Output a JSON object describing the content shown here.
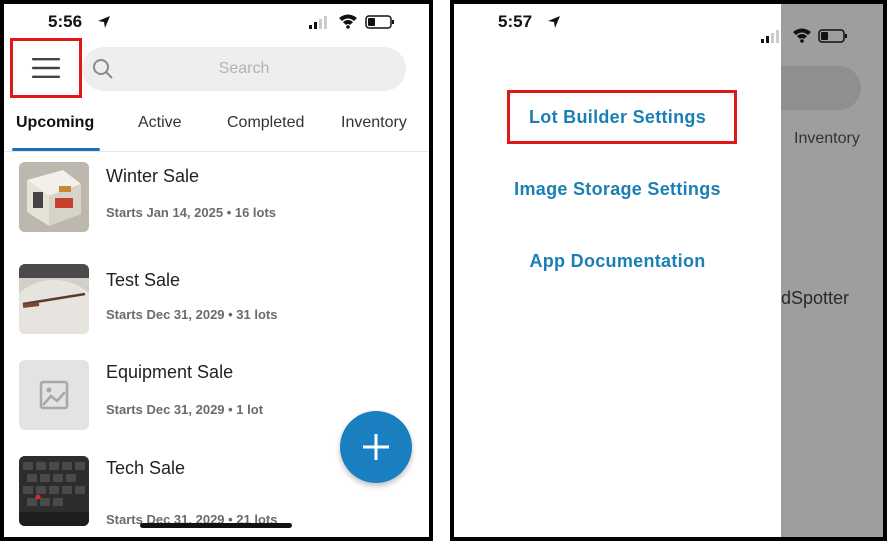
{
  "left_screen": {
    "status": {
      "time": "5:56"
    },
    "search": {
      "placeholder": "Search"
    },
    "tabs": [
      {
        "label": "Upcoming",
        "active": true
      },
      {
        "label": "Active",
        "active": false
      },
      {
        "label": "Completed",
        "active": false
      },
      {
        "label": "Inventory",
        "active": false
      }
    ],
    "sales": [
      {
        "title": "Winter Sale",
        "subtitle": "Starts Jan 14, 2025 • 16 lots",
        "thumbnail": "box-photo"
      },
      {
        "title": "Test Sale",
        "subtitle": "Starts Dec 31, 2029 • 31 lots",
        "thumbnail": "rifle-photo"
      },
      {
        "title": "Equipment Sale",
        "subtitle": "Starts Dec 31, 2029 • 1 lot",
        "thumbnail": "image-placeholder-icon"
      },
      {
        "title": "Tech Sale",
        "subtitle": "Starts Dec 31, 2029 • 21 lots",
        "thumbnail": "laptop-photo"
      }
    ],
    "fab": {
      "icon": "plus-icon"
    }
  },
  "right_screen": {
    "status": {
      "time": "5:57"
    },
    "menu": [
      {
        "label": "Lot Builder Settings",
        "highlighted": true
      },
      {
        "label": "Image Storage Settings"
      },
      {
        "label": "App Documentation"
      }
    ],
    "background": {
      "tab_label": "Inventory",
      "text_fragment": "dSpotter"
    }
  },
  "colors": {
    "accent": "#1a7fc1",
    "highlight_box": "#e01818",
    "overlay": "#9e9e9e"
  }
}
